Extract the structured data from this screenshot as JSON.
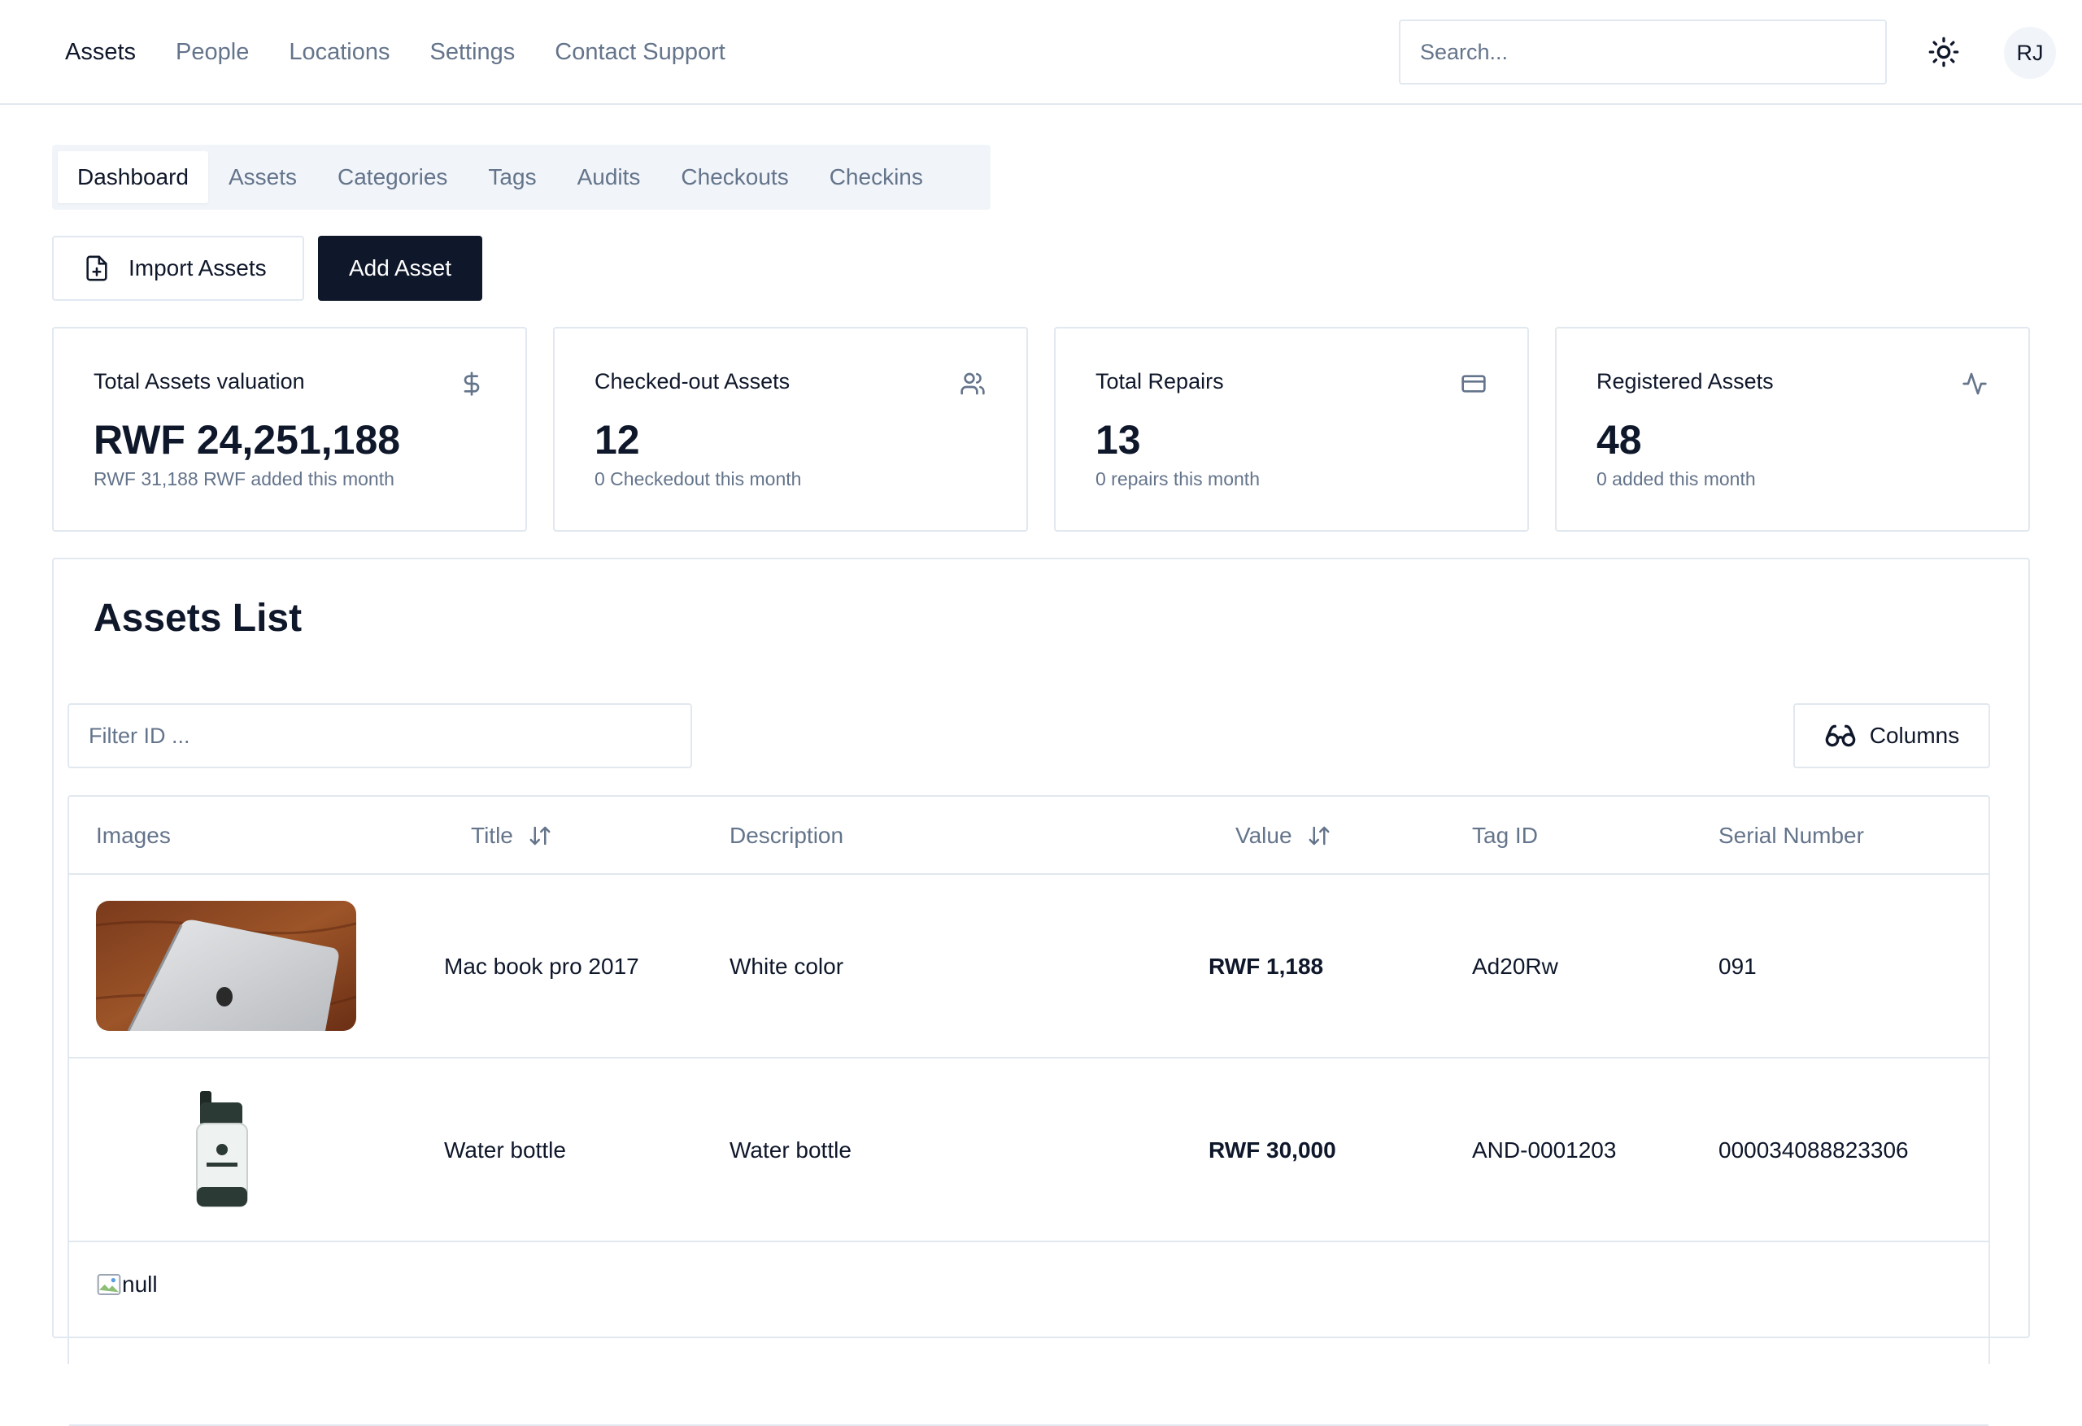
{
  "nav": {
    "items": [
      {
        "label": "Assets",
        "active": true
      },
      {
        "label": "People",
        "active": false
      },
      {
        "label": "Locations",
        "active": false
      },
      {
        "label": "Settings",
        "active": false
      },
      {
        "label": "Contact Support",
        "active": false
      }
    ],
    "search_placeholder": "Search...",
    "theme_icon": "sun-icon",
    "avatar_initials": "RJ"
  },
  "tabs": [
    {
      "label": "Dashboard",
      "active": true
    },
    {
      "label": "Assets",
      "active": false
    },
    {
      "label": "Categories",
      "active": false
    },
    {
      "label": "Tags",
      "active": false
    },
    {
      "label": "Audits",
      "active": false
    },
    {
      "label": "Checkouts",
      "active": false
    },
    {
      "label": "Checkins",
      "active": false
    }
  ],
  "actions": {
    "import_label": "Import Assets",
    "import_icon": "file-plus-icon",
    "add_label": "Add Asset"
  },
  "stats": [
    {
      "label": "Total Assets valuation",
      "value": "RWF 24,251,188",
      "sub": "RWF 31,188 RWF added this month",
      "icon": "dollar-icon"
    },
    {
      "label": "Checked-out Assets",
      "value": "12",
      "sub": "0 Checkedout this month",
      "icon": "users-icon"
    },
    {
      "label": "Total Repairs",
      "value": "13",
      "sub": "0 repairs this month",
      "icon": "credit-card-icon"
    },
    {
      "label": "Registered Assets",
      "value": "48",
      "sub": "0 added this month",
      "icon": "activity-icon"
    }
  ],
  "assets_list": {
    "title": "Assets List",
    "filter_placeholder": "Filter ID ...",
    "columns_label": "Columns",
    "headers": {
      "images": "Images",
      "title": "Title",
      "description": "Description",
      "value": "Value",
      "tag_id": "Tag ID",
      "serial": "Serial Number"
    },
    "rows": [
      {
        "image": "laptop",
        "title": "Mac book pro 2017",
        "description": "White color",
        "value": "RWF 1,188",
        "tag_id": "Ad20Rw",
        "serial": "091"
      },
      {
        "image": "bottle",
        "title": "Water bottle",
        "description": "Water bottle",
        "value": "RWF 30,000",
        "tag_id": "AND-0001203",
        "serial": "000034088823306"
      },
      {
        "image": "broken",
        "image_alt": "null",
        "title": "",
        "description": "",
        "value": "",
        "tag_id": "",
        "serial": ""
      }
    ]
  },
  "colors": {
    "primary": "#0f172a",
    "muted": "#64748b",
    "border": "#e2e8f0",
    "tab_bg": "#f1f5f9"
  }
}
